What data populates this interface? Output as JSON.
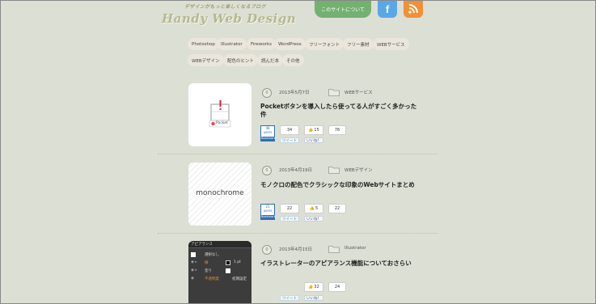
{
  "header": {
    "tagline": "デザインがもっと楽しくなるブログ",
    "logo": "Handy Web Design",
    "about_label": "このサイトについて",
    "facebook_glyph": "f",
    "colors": {
      "about": "#74b072",
      "facebook": "#5aa7e8",
      "rss": "#f0913a"
    }
  },
  "tags": [
    "Photoshop",
    "Illustrator",
    "Fireworks",
    "WordPress",
    "フリーフォント",
    "フリー素材",
    "WEBサービス",
    "WEBデザイン",
    "配色のヒント",
    "読んだ本",
    "その他"
  ],
  "posts": [
    {
      "comments": "0",
      "date": "2013年5月7日",
      "category": "WEBサービス",
      "title_line1": "Pocketボタンを導入したら使ってる人がすごく多かった",
      "title_line2": "件",
      "thumb_label": "Pocket",
      "hatena_count": "48",
      "hatena_users": "users",
      "hatena_label": "Bookmark",
      "twitter_count": "34",
      "like_count": "15",
      "plus_count": "76",
      "tweet_label": "ツイート",
      "like_label": "いいね！",
      "like_btn_label": "15"
    },
    {
      "comments": "0",
      "date": "2013年4月19日",
      "category": "WEBデザイン",
      "title_line1": "モノクロの配色でクラシックな印象のWebサイトまとめ",
      "thumb_label": "monochrome",
      "hatena_count": "21",
      "hatena_users": "users",
      "hatena_label": "Bookmark",
      "twitter_count": "22",
      "like_count": "5",
      "plus_count": "22",
      "tweet_label": "ツイート",
      "like_label": "いいね！"
    },
    {
      "comments": "0",
      "date": "2013年4月15日",
      "category": "Illustrator",
      "title_line1": "イラストレーターのアピアランス機能についておさらい",
      "thumb_panel_title": "アピアランス",
      "thumb_row1": "選択なし",
      "thumb_row2": "線",
      "thumb_row2_value": "1 pt",
      "thumb_row3": "塗り",
      "thumb_row4": "不透明度",
      "thumb_row4_value": "初期設定",
      "like_count": "32",
      "plus_count": "24",
      "tweet_label": "ツイート",
      "like_label": "いいね！"
    }
  ]
}
